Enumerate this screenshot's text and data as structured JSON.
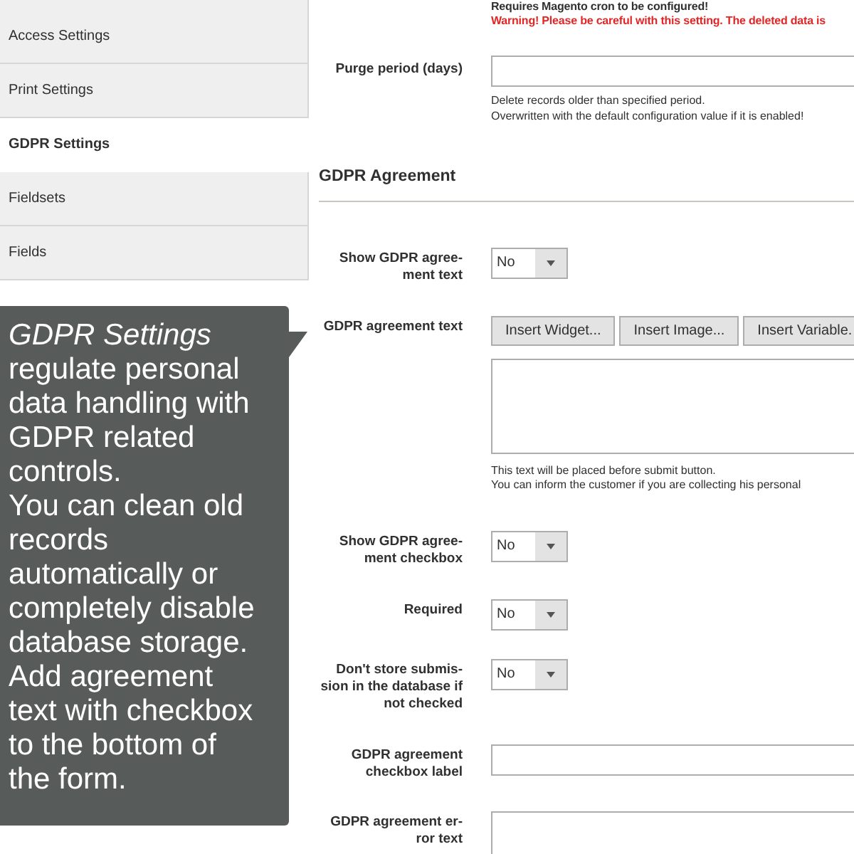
{
  "sidebar": {
    "items": [
      {
        "label": "Access Settings",
        "selected": false
      },
      {
        "label": "Print Settings",
        "selected": false
      },
      {
        "label": "GDPR Settings",
        "selected": true
      },
      {
        "label": "Fieldsets",
        "selected": false
      },
      {
        "label": "Fields",
        "selected": false
      }
    ]
  },
  "tooltip": {
    "text": "*GDPR Settings* regulate personal data handling with GDPR related controls.\nYou can clean old records automatically or completely disable database storage. Add agreement text with checkbox to the bottom of the form."
  },
  "top_notes": [
    {
      "text": "Requires Magento cron to be configured!",
      "kind": "note"
    },
    {
      "text": "Warning! Please be careful with this setting. The deleted data is",
      "kind": "warning"
    }
  ],
  "purge": {
    "label": "Purge period (days)",
    "notes": [
      "Delete records older than specified period.",
      "Overwritten with the default configuration value if it is enabled!"
    ]
  },
  "section": {
    "title": "GDPR Agreement"
  },
  "rows": [
    {
      "kind": "select",
      "label": "Show GDPR agree-\nment text",
      "value": "No"
    },
    {
      "kind": "editor",
      "label": "GDPR agreement text",
      "buttons": [
        "Insert Widget...",
        "Insert Image...",
        "Insert Variable."
      ],
      "notes": [
        "This text will be placed before submit button.",
        "You can inform the customer if you are collecting his personal"
      ]
    },
    {
      "kind": "select",
      "label": "Show GDPR agree-\nment checkbox",
      "value": "No"
    },
    {
      "kind": "select",
      "label": "Required",
      "value": "No"
    },
    {
      "kind": "select",
      "label": "Don't store submis-\nsion in the database if\nnot checked",
      "value": "No"
    },
    {
      "kind": "input",
      "label": "GDPR agreement\ncheckbox label"
    },
    {
      "kind": "textarea",
      "label": "GDPR agreement er-\nror text"
    }
  ]
}
